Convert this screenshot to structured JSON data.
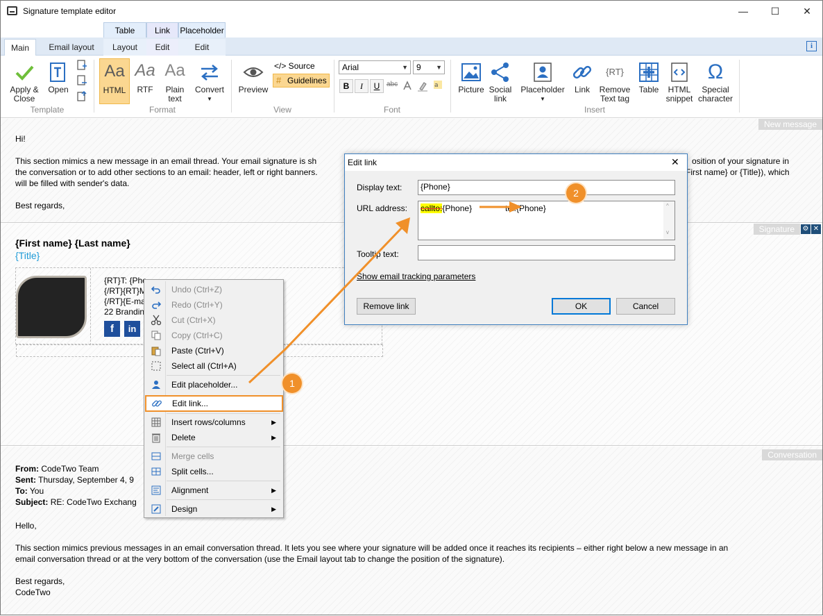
{
  "window": {
    "title": "Signature template editor",
    "controls": {
      "minimize": "—",
      "maximize": "☐",
      "close": "✕"
    }
  },
  "ribbon_tabs": {
    "context_headers": [
      "Table",
      "Link",
      "Placeholder"
    ],
    "tabs": [
      "Main",
      "Email layout",
      "Layout",
      "Edit",
      "Edit"
    ],
    "info": "i"
  },
  "ribbon": {
    "template": {
      "label": "Template",
      "apply_close": "Apply &\nClose",
      "open": "Open"
    },
    "format": {
      "label": "Format",
      "html": "HTML",
      "rtf": "RTF",
      "plain_text": "Plain\ntext",
      "convert": "Convert",
      "aa": "Aa"
    },
    "view": {
      "label": "View",
      "preview": "Preview",
      "source": "</> Source",
      "guidelines": "Guidelines"
    },
    "font": {
      "label": "Font",
      "family": "Arial",
      "size": "9",
      "bold": "B",
      "italic": "I",
      "underline": "U",
      "strike": "abc"
    },
    "insert": {
      "label": "Insert",
      "picture": "Picture",
      "social_link": "Social\nlink",
      "placeholder": "Placeholder",
      "link": "Link",
      "remove_text_tag": "Remove\nText tag",
      "table": "Table",
      "html_snippet": "HTML\nsnippet",
      "special_character": "Special\ncharacter",
      "rt_tag": "{RT}",
      "html_tag": "<>",
      "omega": "Ω"
    }
  },
  "new_message": {
    "label": "New message",
    "greeting": "Hi!",
    "line1_left": "This section mimics a new message in an email thread. Your email signature is sh",
    "line1_right": "osition of your signature in",
    "line2_left": "the conversation or to add other sections to an email: header, left or right banners.",
    "line2_right": "First name} or {Title}), which",
    "line3": "will be filled with sender's data.",
    "closing": "Best regards,"
  },
  "signature": {
    "label": "Signature",
    "name": "{First name} {Last name}",
    "title": "{Title}",
    "lines": [
      "{RT}T: {Pho",
      "{/RT}{RT}M",
      "{/RT}{E-ma",
      "22 Brandin"
    ],
    "fb": "f",
    "in": "in"
  },
  "conversation": {
    "label": "Conversation",
    "from_label": "From:",
    "from": "CodeTwo Team",
    "sent_label": "Sent:",
    "sent": "Thursday, September 4, 9",
    "to_label": "To:",
    "to": "You",
    "subject_label": "Subject:",
    "subject": "RE: CodeTwo Exchang",
    "greeting": "Hello,",
    "body_line1": "This section mimics previous messages in an email conversation thread. It lets you see where your signature will be added once it reaches its recipients – either right below a new message in an",
    "body_line2": "email conversation thread or at the very bottom of the conversation (use the Email layout tab to change the position of the signature).",
    "closing": "Best regards,",
    "signoff": "CodeTwo"
  },
  "context_menu": {
    "undo": "Undo (Ctrl+Z)",
    "redo": "Redo (Ctrl+Y)",
    "cut": "Cut (Ctrl+X)",
    "copy": "Copy (Ctrl+C)",
    "paste": "Paste (Ctrl+V)",
    "select_all": "Select all (Ctrl+A)",
    "edit_placeholder": "Edit placeholder...",
    "edit_link": "Edit link...",
    "insert_rows_columns": "Insert rows/columns",
    "delete": "Delete",
    "merge_cells": "Merge cells",
    "split_cells": "Split cells...",
    "alignment": "Alignment",
    "design": "Design",
    "submenu_arrow": "▶"
  },
  "dialog": {
    "title": "Edit link",
    "display_text_label": "Display text:",
    "display_text": "{Phone}",
    "url_label": "URL address:",
    "url_struck": "callto:",
    "url_rest": "{Phone}",
    "url_new": "tel:{Phone}",
    "tooltip_label": "Tooltip text:",
    "tooltip_value": "",
    "tracking_link": "Show email tracking parameters",
    "remove_link": "Remove link",
    "ok": "OK",
    "cancel": "Cancel",
    "close": "✕"
  },
  "annotations": {
    "step1": "1",
    "step2": "2"
  },
  "colors": {
    "accent": "#f0902a",
    "link_blue": "#1f9bd7",
    "selection": "#fbd791",
    "highlight": "#ffff00"
  }
}
